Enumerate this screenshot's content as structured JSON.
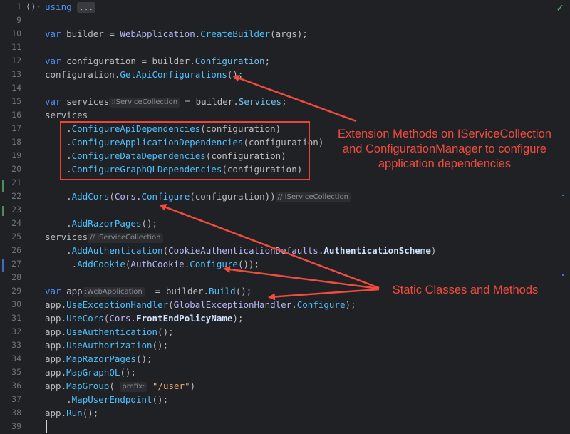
{
  "editor": {
    "lines": [
      {
        "n": "1",
        "parts": [
          {
            "t": "using ",
            "c": "kw"
          },
          {
            "t": "...",
            "c": "using-box"
          }
        ]
      },
      {
        "n": "9",
        "parts": []
      },
      {
        "n": "10",
        "parts": [
          {
            "t": "var ",
            "c": "kw"
          },
          {
            "t": "builder = "
          },
          {
            "t": "WebApplication",
            "c": "type"
          },
          {
            "t": "."
          },
          {
            "t": "CreateBuilder",
            "c": "fn"
          },
          {
            "t": "(args);"
          }
        ]
      },
      {
        "n": "11",
        "parts": []
      },
      {
        "n": "12",
        "parts": [
          {
            "t": "var ",
            "c": "kw"
          },
          {
            "t": "configuration = builder."
          },
          {
            "t": "Configuration",
            "c": "prop"
          },
          {
            "t": ";"
          }
        ]
      },
      {
        "n": "13",
        "parts": [
          {
            "t": "configuration."
          },
          {
            "t": "GetApiConfigurations",
            "c": "fn"
          },
          {
            "t": "();"
          }
        ]
      },
      {
        "n": "14",
        "parts": []
      },
      {
        "n": "15",
        "parts": [
          {
            "t": "var ",
            "c": "kw"
          },
          {
            "t": "services"
          },
          {
            "t": ":IServiceCollection",
            "c": "hint"
          },
          {
            "t": " = builder."
          },
          {
            "t": "Services",
            "c": "prop"
          },
          {
            "t": ";"
          }
        ]
      },
      {
        "n": "16",
        "parts": [
          {
            "t": "services"
          }
        ]
      },
      {
        "n": "17",
        "parts": [
          {
            "t": "    ."
          },
          {
            "t": "ConfigureApiDependencies",
            "c": "fn"
          },
          {
            "t": "(configuration)"
          }
        ]
      },
      {
        "n": "18",
        "parts": [
          {
            "t": "    ."
          },
          {
            "t": "ConfigureApplicationDependencies",
            "c": "fn"
          },
          {
            "t": "(configuration)"
          }
        ]
      },
      {
        "n": "19",
        "parts": [
          {
            "t": "    ."
          },
          {
            "t": "ConfigureDataDependencies",
            "c": "fn"
          },
          {
            "t": "(configuration)"
          }
        ]
      },
      {
        "n": "20",
        "parts": [
          {
            "t": "    ."
          },
          {
            "t": "ConfigureGraphQLDependencies",
            "c": "fn"
          },
          {
            "t": "(configuration)"
          }
        ]
      },
      {
        "n": "21",
        "parts": []
      },
      {
        "n": "22",
        "parts": [
          {
            "t": "    ."
          },
          {
            "t": "AddCors",
            "c": "fn"
          },
          {
            "t": "("
          },
          {
            "t": "Cors",
            "c": "type"
          },
          {
            "t": "."
          },
          {
            "t": "Configure",
            "c": "fn"
          },
          {
            "t": "(configuration))"
          },
          {
            "t": "// IServiceCollection",
            "c": "hint"
          }
        ]
      },
      {
        "n": "23",
        "parts": []
      },
      {
        "n": "24",
        "parts": [
          {
            "t": "    ."
          },
          {
            "t": "AddRazorPages",
            "c": "fn"
          },
          {
            "t": "();"
          }
        ]
      },
      {
        "n": "25",
        "parts": [
          {
            "t": "services"
          },
          {
            "t": "// IServiceCollection",
            "c": "hint"
          }
        ]
      },
      {
        "n": "26",
        "parts": [
          {
            "t": "    ."
          },
          {
            "t": "AddAuthentication",
            "c": "fn"
          },
          {
            "t": "("
          },
          {
            "t": "CookieAuthenticationDefaults",
            "c": "type"
          },
          {
            "t": "."
          },
          {
            "t": "AuthenticationScheme",
            "c": "bold"
          },
          {
            "t": ")"
          }
        ]
      },
      {
        "n": "27",
        "parts": [
          {
            "t": "     ."
          },
          {
            "t": "AddCookie",
            "c": "fn"
          },
          {
            "t": "("
          },
          {
            "t": "AuthCookie",
            "c": "type"
          },
          {
            "t": "."
          },
          {
            "t": "Configure",
            "c": "fn"
          },
          {
            "t": "());"
          }
        ]
      },
      {
        "n": "28",
        "parts": []
      },
      {
        "n": "29",
        "parts": [
          {
            "t": "var ",
            "c": "kw"
          },
          {
            "t": "app"
          },
          {
            "t": ":WebApplication",
            "c": "hint"
          },
          {
            "t": "  = builder."
          },
          {
            "t": "Build",
            "c": "fn"
          },
          {
            "t": "();"
          }
        ]
      },
      {
        "n": "30",
        "parts": [
          {
            "t": "app."
          },
          {
            "t": "UseExceptionHandler",
            "c": "fn"
          },
          {
            "t": "("
          },
          {
            "t": "GlobalExceptionHandler",
            "c": "type"
          },
          {
            "t": "."
          },
          {
            "t": "Configure",
            "c": "fn"
          },
          {
            "t": ");"
          }
        ]
      },
      {
        "n": "31",
        "parts": [
          {
            "t": "app."
          },
          {
            "t": "UseCors",
            "c": "fn"
          },
          {
            "t": "("
          },
          {
            "t": "Cors",
            "c": "type"
          },
          {
            "t": "."
          },
          {
            "t": "FrontEndPolicyName",
            "c": "bold"
          },
          {
            "t": ");"
          }
        ]
      },
      {
        "n": "32",
        "parts": [
          {
            "t": "app."
          },
          {
            "t": "UseAuthentication",
            "c": "fn"
          },
          {
            "t": "();"
          }
        ]
      },
      {
        "n": "33",
        "parts": [
          {
            "t": "app."
          },
          {
            "t": "UseAuthorization",
            "c": "fn"
          },
          {
            "t": "();"
          }
        ]
      },
      {
        "n": "34",
        "parts": [
          {
            "t": "app."
          },
          {
            "t": "MapRazorPages",
            "c": "fn"
          },
          {
            "t": "();"
          }
        ]
      },
      {
        "n": "35",
        "parts": [
          {
            "t": "app."
          },
          {
            "t": "MapGraphQL",
            "c": "fn"
          },
          {
            "t": "();"
          }
        ]
      },
      {
        "n": "36",
        "parts": [
          {
            "t": "app."
          },
          {
            "t": "MapGroup",
            "c": "fn"
          },
          {
            "t": "( "
          },
          {
            "t": "prefix:",
            "c": "hint"
          },
          {
            "t": " "
          },
          {
            "t": "\"/user\"",
            "c": "str"
          },
          {
            "t": ")"
          }
        ]
      },
      {
        "n": "37",
        "parts": [
          {
            "t": "    ."
          },
          {
            "t": "MapUserEndpoint",
            "c": "fn"
          },
          {
            "t": "();"
          }
        ]
      },
      {
        "n": "38",
        "parts": [
          {
            "t": "app."
          },
          {
            "t": "Run",
            "c": "fn"
          },
          {
            "t": "();"
          }
        ]
      },
      {
        "n": "39",
        "parts": []
      }
    ],
    "fold_icon": "⟨⟩",
    "chevron": "›",
    "check_icon": "✓"
  },
  "annotations": {
    "extension_note": [
      "Extension Methods on IServiceCollection",
      "and ConfigurationManager to configure",
      "application dependencies"
    ],
    "static_note": "Static Classes and Methods"
  },
  "colors": {
    "background": "#1f2125",
    "annotation": "#f04c3e",
    "keyword": "#4e8ff7",
    "method": "#4fc1ff"
  }
}
